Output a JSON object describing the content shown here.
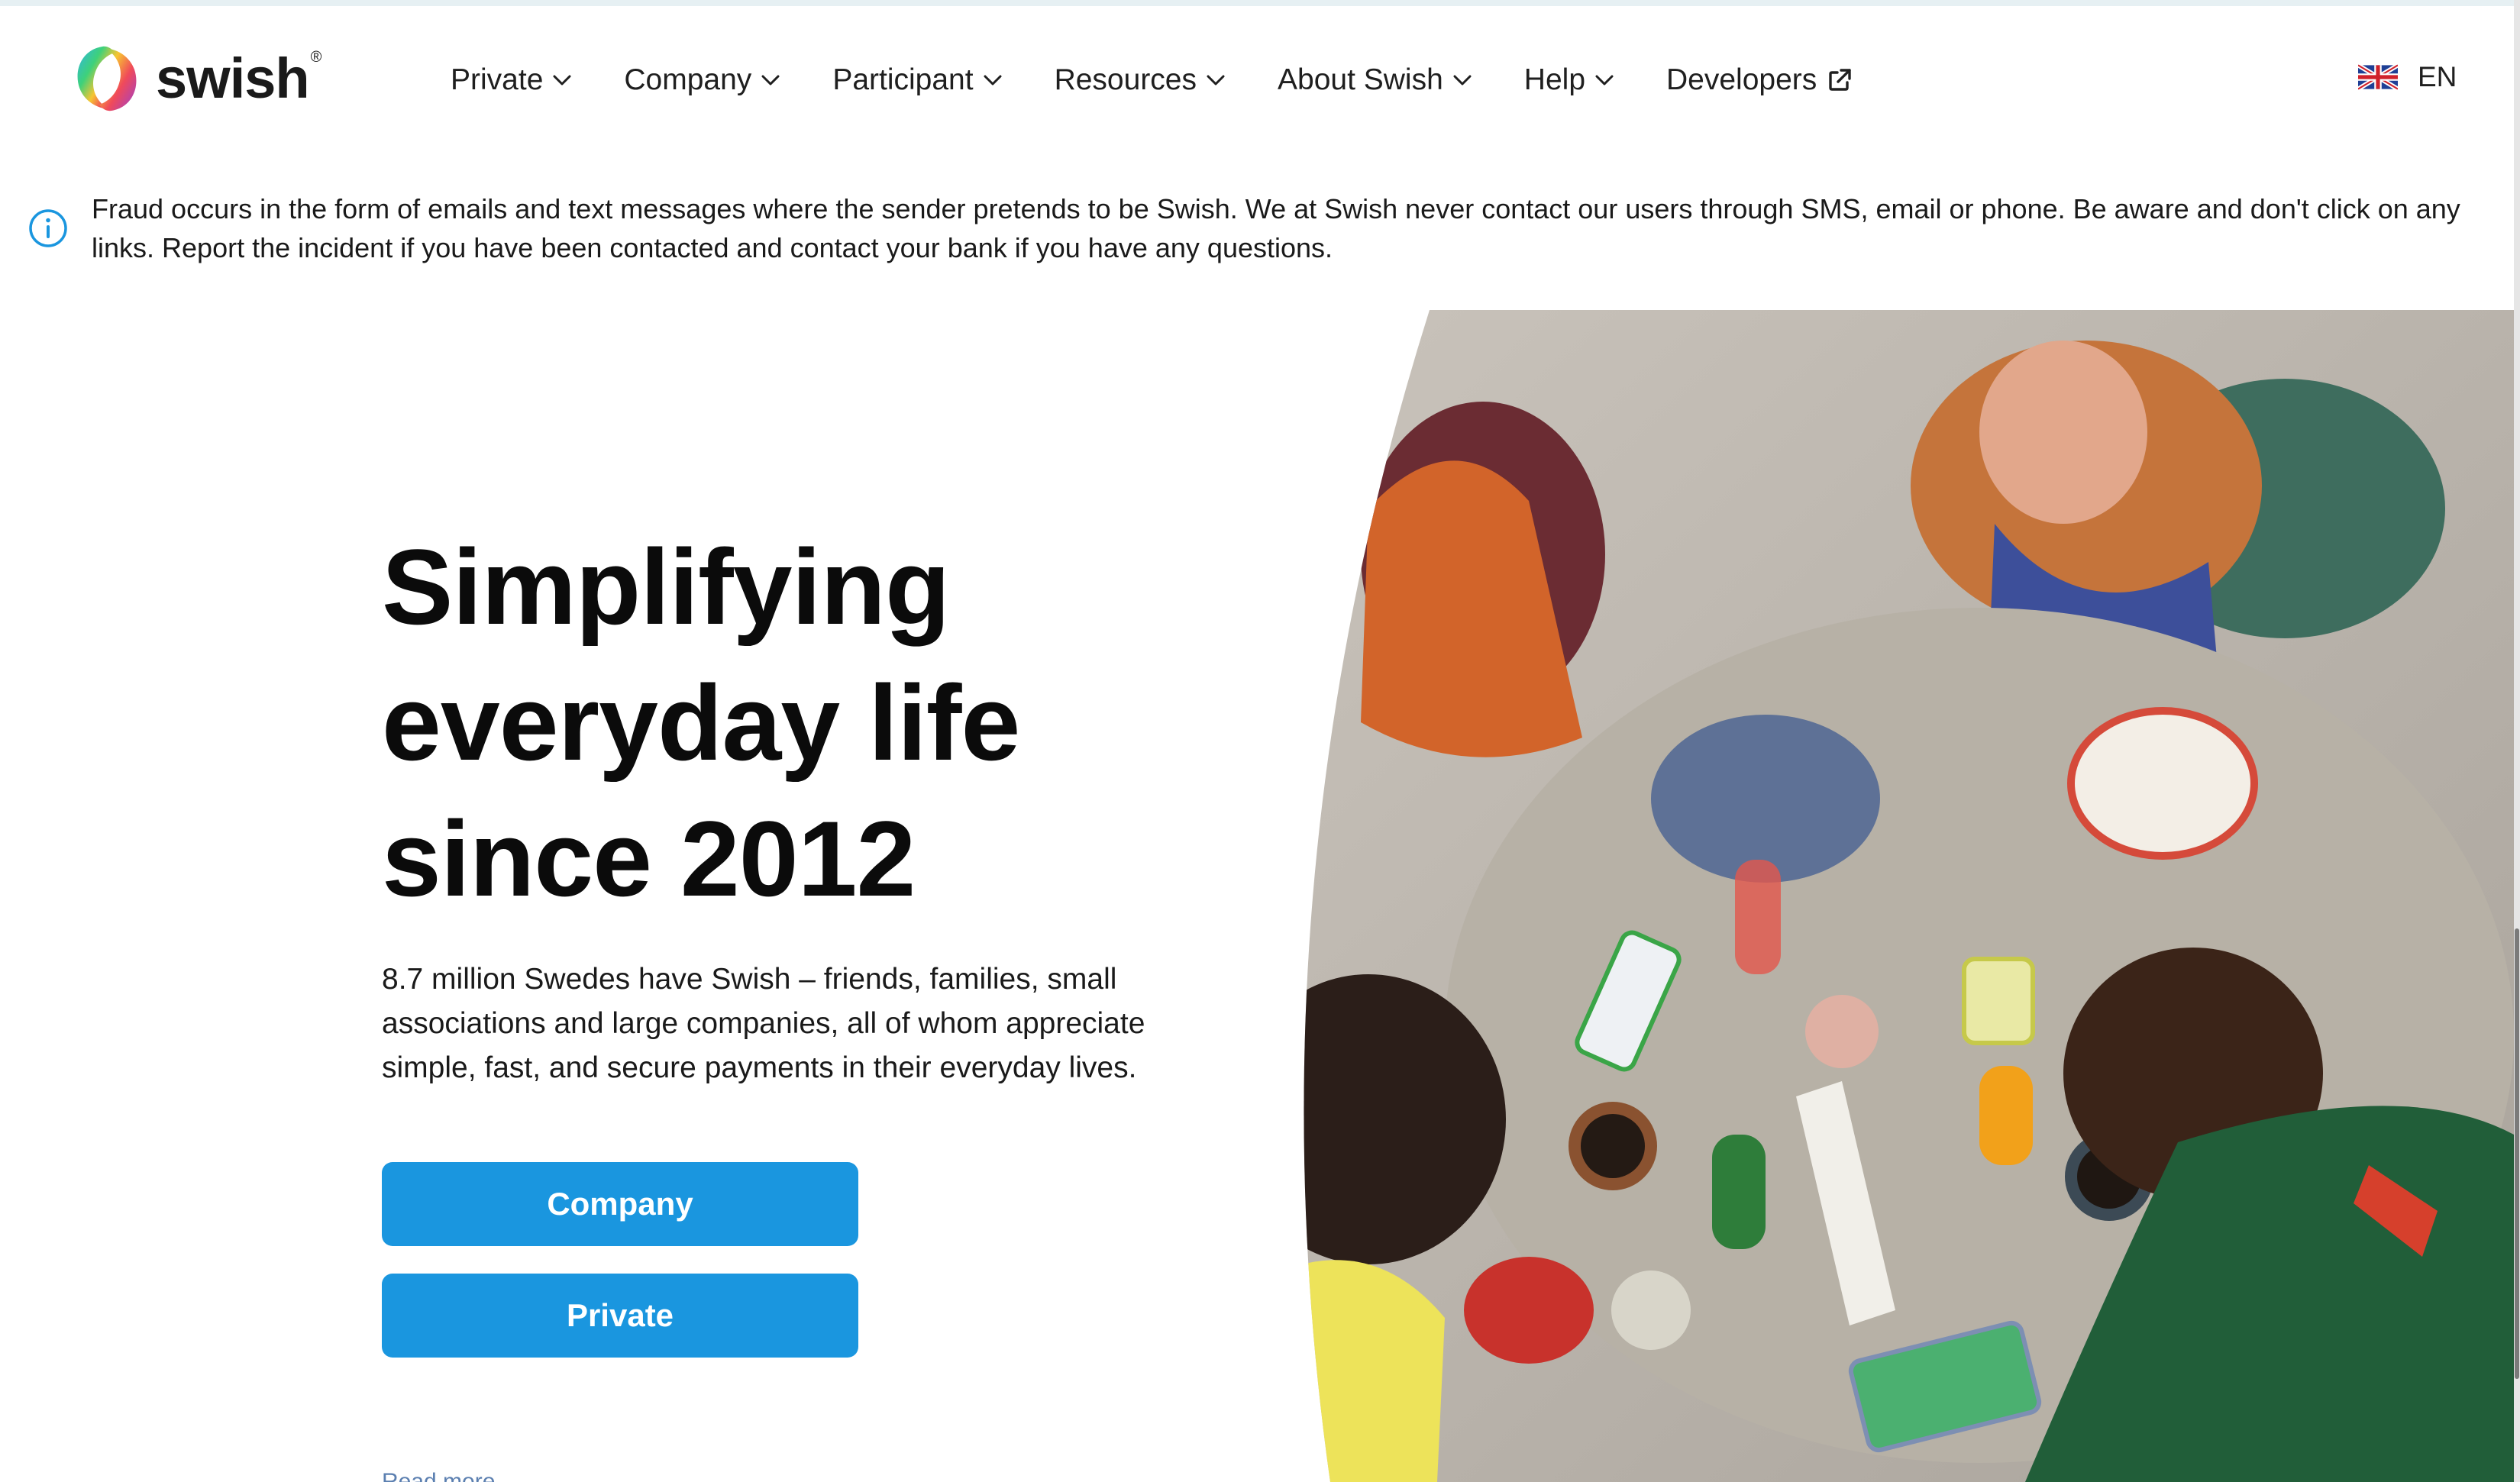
{
  "brand": {
    "name": "swish",
    "registered_mark": "®",
    "gradient_colors": [
      "#2fb5e8",
      "#3ed17a",
      "#f7c531",
      "#f04a5a",
      "#9b3fd1"
    ]
  },
  "nav": {
    "items": [
      {
        "label": "Private",
        "icon": "chevron-down-icon"
      },
      {
        "label": "Company",
        "icon": "chevron-down-icon"
      },
      {
        "label": "Participant",
        "icon": "chevron-down-icon"
      },
      {
        "label": "Resources",
        "icon": "chevron-down-icon"
      },
      {
        "label": "About Swish",
        "icon": "chevron-down-icon"
      },
      {
        "label": "Help",
        "icon": "chevron-down-icon"
      },
      {
        "label": "Developers",
        "icon": "external-link-icon"
      }
    ]
  },
  "language": {
    "code": "EN",
    "icon": "uk-flag-icon"
  },
  "notice": {
    "icon": "info-icon",
    "text": "Fraud occurs in the form of emails and text messages where the sender pretends to be Swish. We at Swish never contact our users through SMS, email or phone. Be aware and don't click on any links. Report the incident if you have been contacted and contact your bank if you have any questions."
  },
  "hero": {
    "title": "Simplifying everyday life since 2012",
    "subtitle": "8.7 million Swedes have Swish – friends, families, small associations and large companies, all of whom appreciate simple, fast, and secure payments in their everyday lives.",
    "buttons": {
      "company": "Company",
      "private": "Private"
    },
    "read_more": "Read more",
    "image": "photo of friends at a cafe table using phones"
  },
  "colors": {
    "button": "#1a96df",
    "info_icon": "#1a96df",
    "text": "#111111"
  }
}
